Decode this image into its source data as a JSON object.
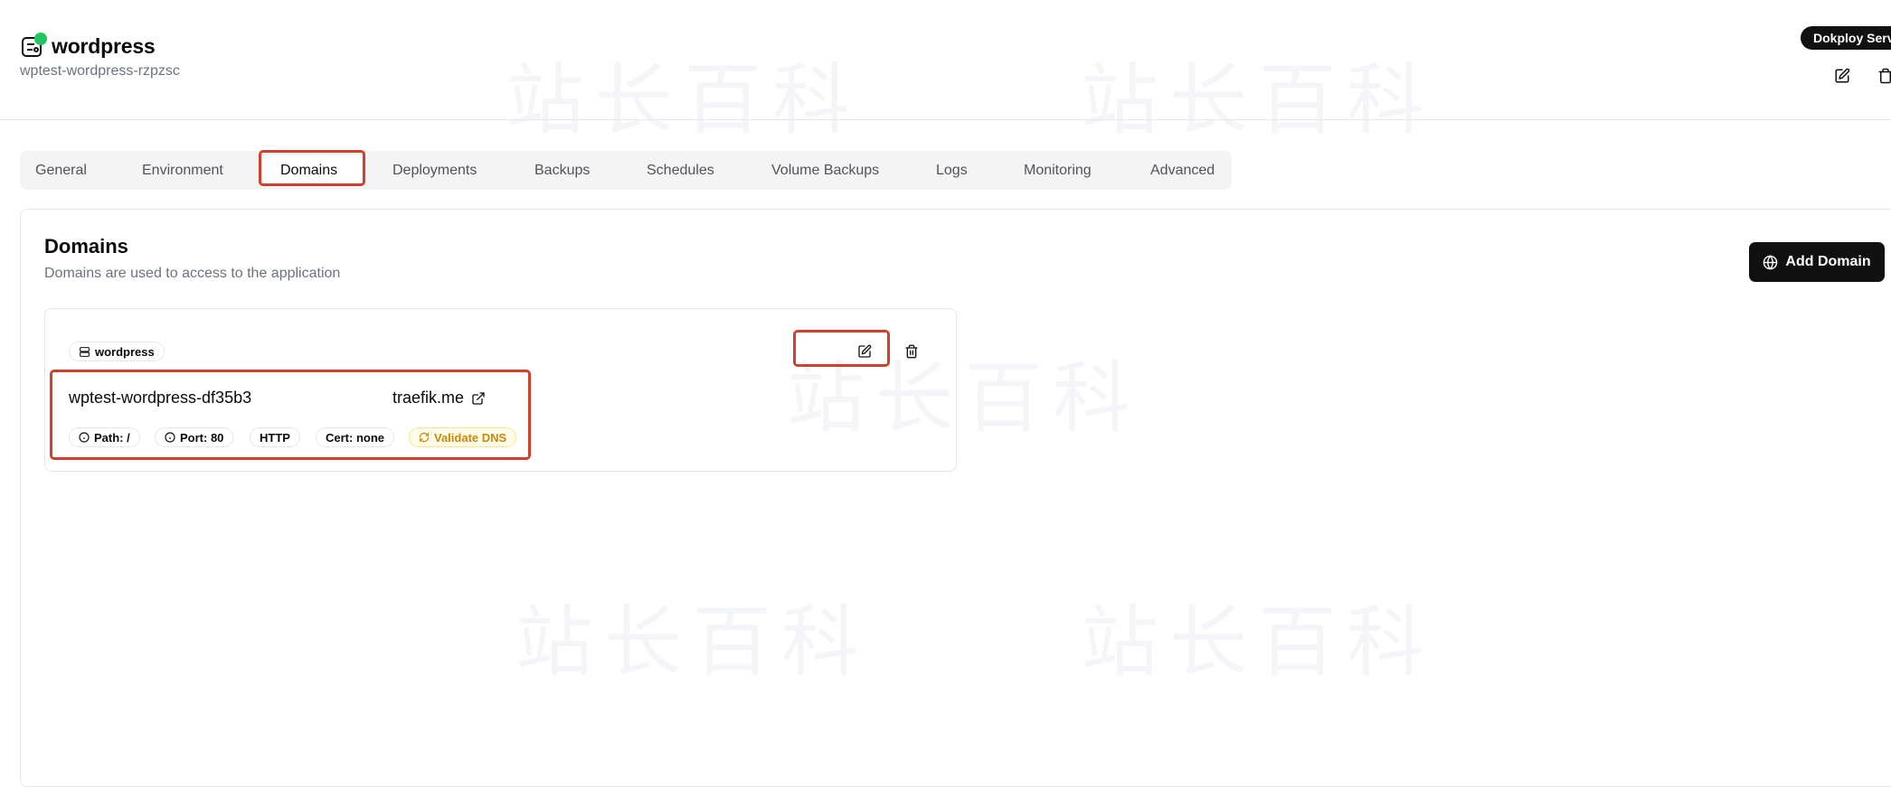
{
  "app": {
    "title": "wordpress",
    "subtitle": "wptest-wordpress-rzpzsc",
    "status_color": "#22c55e"
  },
  "header": {
    "server_badge": "Dokploy Server",
    "icons": [
      "edit-icon",
      "trash-icon"
    ]
  },
  "tabs": [
    {
      "label": "General"
    },
    {
      "label": "Environment"
    },
    {
      "label": "Domains",
      "active": true
    },
    {
      "label": "Deployments"
    },
    {
      "label": "Backups"
    },
    {
      "label": "Schedules"
    },
    {
      "label": "Volume Backups"
    },
    {
      "label": "Logs"
    },
    {
      "label": "Monitoring"
    },
    {
      "label": "Advanced"
    }
  ],
  "domains_section": {
    "title": "Domains",
    "description": "Domains are used to access to the application",
    "add_button": "Add Domain"
  },
  "domain_card": {
    "service_chip": "wordpress",
    "host": "wptest-wordpress-df35b3",
    "tld": "traefik.me",
    "chips": {
      "path": "Path: /",
      "port": "Port: 80",
      "protocol": "HTTP",
      "cert": "Cert: none",
      "validate": "Validate DNS"
    }
  },
  "watermark": "站长百科",
  "colors": {
    "highlight": "#d0402b",
    "warning": "#ca8a04"
  }
}
